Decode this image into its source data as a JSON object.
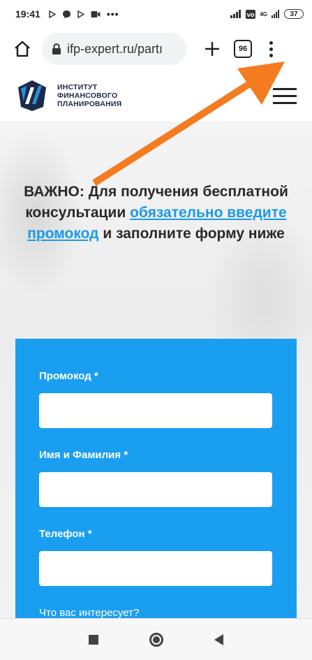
{
  "status_bar": {
    "time": "19:41",
    "notification_icons": [
      "play-store-icon",
      "chat-icon",
      "play-store-icon",
      "video-icon",
      "more-dots-icon"
    ],
    "network": "4G",
    "battery": "37"
  },
  "browser": {
    "url": "ifp-expert.ru/partı",
    "tabs_count": "96"
  },
  "site": {
    "logo_lines": [
      "ИНСТИТУТ",
      "ФИНАНСОВОГО",
      "ПЛАНИРОВАНИЯ"
    ]
  },
  "hero": {
    "headline_part1": "ВАЖНО: Для получения бесплатной консультации ",
    "link1": "обязательно введите",
    "headline_part2": " ",
    "link2": "промокод",
    "headline_part3": " и заполните форму ниже"
  },
  "form": {
    "fields": [
      {
        "label": "Промокод *",
        "value": ""
      },
      {
        "label": "Имя и Фамилия *",
        "value": ""
      },
      {
        "label": "Телефон *",
        "value": ""
      }
    ],
    "interest_label": "Что вас интересует?"
  },
  "colors": {
    "accent": "#1a9ef0",
    "link": "#1a9ae8",
    "arrow": "#f47b20",
    "logo_navy": "#1c2b4a"
  }
}
